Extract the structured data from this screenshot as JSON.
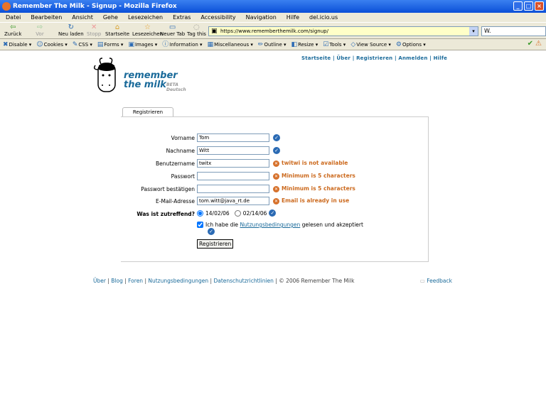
{
  "window": {
    "title": "Remember The Milk - Signup - Mozilla Firefox"
  },
  "menu": [
    "Datei",
    "Bearbeiten",
    "Ansicht",
    "Gehe",
    "Lesezeichen",
    "Extras",
    "Accessibility",
    "Navigation",
    "Hilfe",
    "del.icio.us"
  ],
  "nav": {
    "back": "Zurück",
    "forward": "Vor",
    "reload": "Neu laden",
    "stop": "Stopp",
    "home": "Startseite",
    "bookmarks": "Lesezeichen",
    "newtab": "Neuer Tab",
    "tagthis": "Tag this",
    "url": "https://www.rememberthemilk.com/signup/",
    "search": "W."
  },
  "devbar": [
    "Disable",
    "Cookies",
    "CSS",
    "Forms",
    "Images",
    "Information",
    "Miscellaneous",
    "Outline",
    "Resize",
    "Tools",
    "View Source",
    "Options"
  ],
  "topnav": {
    "items": [
      "Startseite",
      "Über",
      "Registrieren",
      "Anmelden",
      "Hilfe"
    ],
    "separator": " | "
  },
  "logo": {
    "line1": "remember",
    "line2": "the milk",
    "beta": "BETA",
    "lang": "Deutsch"
  },
  "tab": "Registrieren",
  "form": {
    "fields": [
      {
        "label": "Vorname",
        "value": "Tom",
        "status": "ok",
        "message": ""
      },
      {
        "label": "Nachname",
        "value": "Witt",
        "status": "ok",
        "message": ""
      },
      {
        "label": "Benutzername",
        "value": "twitx",
        "status": "error",
        "message": "twitwi is not available"
      },
      {
        "label": "Passwort",
        "value": "",
        "status": "error",
        "message": "Minimum is 5 characters"
      },
      {
        "label": "Passwort bestätigen",
        "value": "",
        "status": "error",
        "message": "Minimum is 5 characters"
      },
      {
        "label": "E-Mail-Adresse",
        "value": "tom.witt@java_rt.de",
        "status": "error",
        "message": "Email is already in use"
      }
    ],
    "date_label": "Was ist zutreffend?",
    "date_options": [
      "14/02/06",
      "02/14/06"
    ],
    "date_selected": 0,
    "terms_pre": "Ich habe die ",
    "terms_link": "Nutzungsbedingungen",
    "terms_post": " gelesen und akzeptiert",
    "terms_checked": true,
    "submit": "Registrieren"
  },
  "footer": {
    "links": [
      "Über",
      "Blog",
      "Foren",
      "Nutzungsbedingungen",
      "Datenschutzrichtlinien"
    ],
    "copyright": "© 2006 Remember The Milk",
    "feedback": "Feedback"
  },
  "colors": {
    "link": "#1a6a9a",
    "error": "#cc6a1e",
    "ok": "#2a6ab4",
    "titlebar": "#0a4fd8"
  }
}
